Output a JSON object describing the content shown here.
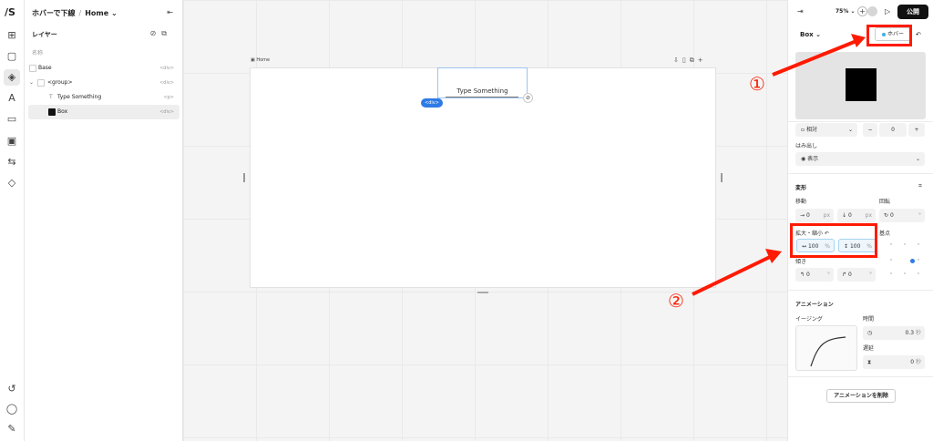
{
  "app": {
    "logo": "/S"
  },
  "breadcrumb": {
    "page": "ホバーで下線",
    "separator": "/",
    "current": "Home",
    "caret": "⌄"
  },
  "layers": {
    "title": "レイヤー",
    "column": "名称",
    "items": [
      {
        "label": "Base",
        "tag": "<div>"
      },
      {
        "label": "<group>",
        "tag": "<div>"
      },
      {
        "label": "Type Something",
        "tag": "<p>"
      },
      {
        "label": "Box",
        "tag": "<div>"
      }
    ]
  },
  "canvas": {
    "frame_label": "Home",
    "element_text": "Type Something",
    "badge": "<div>"
  },
  "inspector": {
    "zoom": "75% ⌄",
    "publish": "公開",
    "element_name": "Box ⌄",
    "state_chip": "ホバー",
    "position": {
      "value": "相対",
      "number": "0",
      "minus": "−",
      "plus": "+"
    },
    "overflow": {
      "label": "はみ出し",
      "value": "表示"
    },
    "transform": {
      "title": "変形",
      "move_label": "移動",
      "rotate_label": "回転",
      "move_x": "0",
      "move_y": "0",
      "move_unit": "px",
      "rotate": "0",
      "rotate_unit": "°",
      "scale_label": "拡大・縮小",
      "scale_x": "100",
      "scale_y": "100",
      "scale_unit": "%",
      "origin_label": "基点",
      "skew_label": "傾き",
      "skew_x": "0",
      "skew_y": "0",
      "skew_unit": "°"
    },
    "animation": {
      "title": "アニメーション",
      "easing_label": "イージング",
      "duration_label": "時間",
      "duration": "0.3",
      "duration_unit": "秒",
      "delay_label": "遅延",
      "delay": "0",
      "delay_unit": "秒",
      "delete_button": "アニメーションを削除"
    }
  },
  "annotations": {
    "one": "①",
    "two": "②",
    "color": "#ff1a00"
  }
}
